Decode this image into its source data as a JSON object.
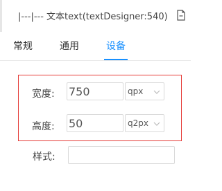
{
  "header": {
    "title": "|---|--- 文本text(textDesigner:540)",
    "icon": "document-icon"
  },
  "tabs": [
    {
      "label": "常规",
      "active": false
    },
    {
      "label": "通用",
      "active": false
    },
    {
      "label": "设备",
      "active": true
    }
  ],
  "device": {
    "width": {
      "label": "宽度:",
      "value": "750",
      "unit": "qpx",
      "icon": "chevron-down-icon"
    },
    "height": {
      "label": "高度:",
      "value": "50",
      "unit": "q2px",
      "icon": "chevron-down-icon"
    },
    "style": {
      "label": "样式:",
      "value": ""
    }
  },
  "colors": {
    "accent": "#1890ff",
    "highlight_border": "#e53935"
  }
}
